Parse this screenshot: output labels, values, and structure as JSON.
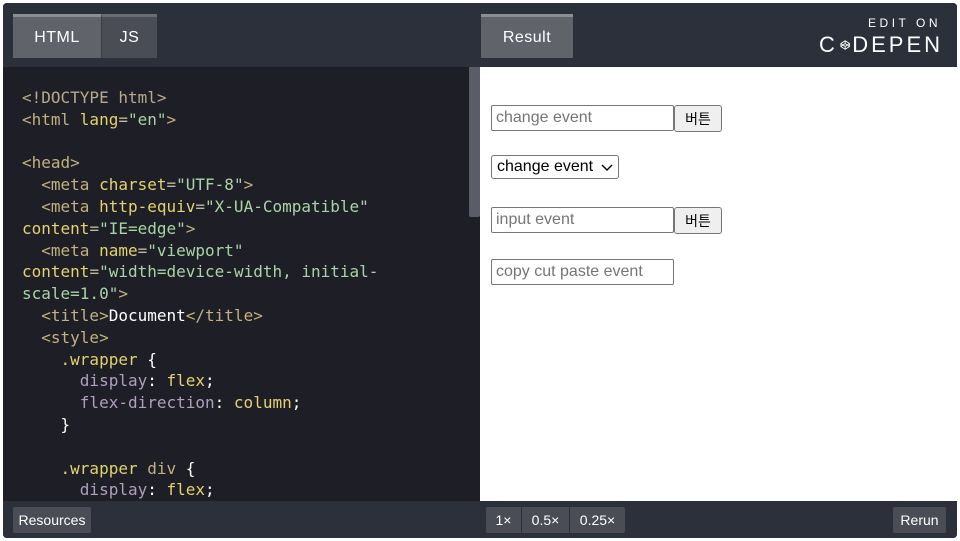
{
  "topbar": {
    "tabs": [
      {
        "label": "HTML"
      },
      {
        "label": "JS"
      }
    ],
    "result_tab": "Result",
    "logo": {
      "edit_on": "EDIT ON",
      "brand_left": "C",
      "brand_right": "DEPEN"
    }
  },
  "editor": {
    "lines": [
      [
        {
          "c": "t-doc",
          "t": "<!DOCTYPE html>"
        }
      ],
      [
        {
          "c": "t-tag",
          "t": "<html "
        },
        {
          "c": "t-attr",
          "t": "lang"
        },
        {
          "c": "t-punc",
          "t": "="
        },
        {
          "c": "t-str",
          "t": "\"en\""
        },
        {
          "c": "t-tag",
          "t": ">"
        }
      ],
      [],
      [
        {
          "c": "t-tag",
          "t": "<head>"
        }
      ],
      [
        {
          "c": "t-tag",
          "t": "  <meta "
        },
        {
          "c": "t-attr",
          "t": "charset"
        },
        {
          "c": "t-punc",
          "t": "="
        },
        {
          "c": "t-str",
          "t": "\"UTF-8\""
        },
        {
          "c": "t-tag",
          "t": ">"
        }
      ],
      [
        {
          "c": "t-tag",
          "t": "  <meta "
        },
        {
          "c": "t-attr",
          "t": "http-equiv"
        },
        {
          "c": "t-punc",
          "t": "="
        },
        {
          "c": "t-str",
          "t": "\"X-UA-Compatible\""
        }
      ],
      [
        {
          "c": "t-attr",
          "t": "content"
        },
        {
          "c": "t-punc",
          "t": "="
        },
        {
          "c": "t-str",
          "t": "\"IE=edge\""
        },
        {
          "c": "t-tag",
          "t": ">"
        }
      ],
      [
        {
          "c": "t-tag",
          "t": "  <meta "
        },
        {
          "c": "t-attr",
          "t": "name"
        },
        {
          "c": "t-punc",
          "t": "="
        },
        {
          "c": "t-str",
          "t": "\"viewport\""
        }
      ],
      [
        {
          "c": "t-attr",
          "t": "content"
        },
        {
          "c": "t-punc",
          "t": "="
        },
        {
          "c": "t-str",
          "t": "\"width=device-width, initial-"
        }
      ],
      [
        {
          "c": "t-str",
          "t": "scale=1.0\""
        },
        {
          "c": "t-tag",
          "t": ">"
        }
      ],
      [
        {
          "c": "t-tag",
          "t": "  <title>"
        },
        {
          "c": "t-plain",
          "t": "Document"
        },
        {
          "c": "t-tag",
          "t": "</title>"
        }
      ],
      [
        {
          "c": "t-tag",
          "t": "  <style>"
        }
      ],
      [
        {
          "c": "t-sel",
          "t": "    .wrapper "
        },
        {
          "c": "t-plain",
          "t": "{"
        }
      ],
      [
        {
          "c": "t-prop",
          "t": "      display"
        },
        {
          "c": "t-plain",
          "t": ": "
        },
        {
          "c": "t-val",
          "t": "flex"
        },
        {
          "c": "t-plain",
          "t": ";"
        }
      ],
      [
        {
          "c": "t-prop",
          "t": "      flex-direction"
        },
        {
          "c": "t-plain",
          "t": ": "
        },
        {
          "c": "t-val",
          "t": "column"
        },
        {
          "c": "t-plain",
          "t": ";"
        }
      ],
      [
        {
          "c": "t-plain",
          "t": "    }"
        }
      ],
      [],
      [
        {
          "c": "t-sel",
          "t": "    .wrapper "
        },
        {
          "c": "t-tag",
          "t": "div "
        },
        {
          "c": "t-plain",
          "t": "{"
        }
      ],
      [
        {
          "c": "t-prop",
          "t": "      display"
        },
        {
          "c": "t-plain",
          "t": ": "
        },
        {
          "c": "t-val",
          "t": "flex"
        },
        {
          "c": "t-plain",
          "t": ";"
        }
      ]
    ]
  },
  "result": {
    "change_input_placeholder": "change event",
    "button_label": "버튼",
    "select_value": "change event",
    "input_event_placeholder": "input event",
    "button2_label": "버튼",
    "copy_input_placeholder": "copy cut paste event"
  },
  "bottombar": {
    "resources": "Resources",
    "zoom": [
      "1×",
      "0.5×",
      "0.25×"
    ],
    "rerun": "Rerun"
  }
}
